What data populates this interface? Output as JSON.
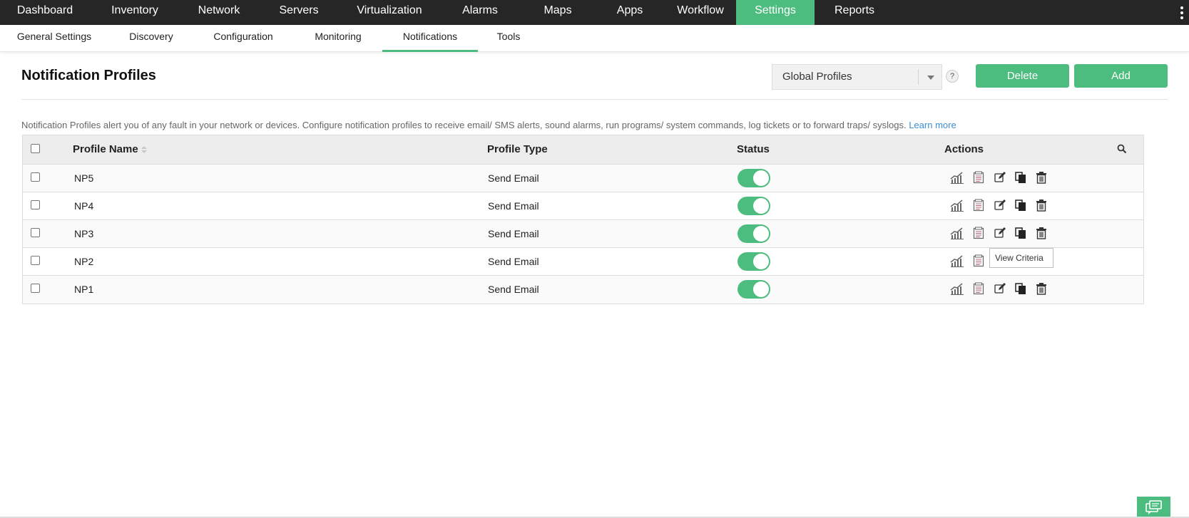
{
  "topnav": {
    "items": [
      "Dashboard",
      "Inventory",
      "Network",
      "Servers",
      "Virtualization",
      "Alarms",
      "Maps",
      "Apps",
      "Workflow",
      "Settings",
      "Reports"
    ],
    "active": "Settings"
  },
  "subnav": {
    "items": [
      "General Settings",
      "Discovery",
      "Configuration",
      "Monitoring",
      "Notifications",
      "Tools"
    ],
    "active": "Notifications"
  },
  "page": {
    "title": "Notification Profiles",
    "profile_select": "Global Profiles",
    "help": "?",
    "delete_label": "Delete",
    "add_label": "Add",
    "description": "Notification Profiles alert you of any fault in your network or devices. Configure notification profiles to receive email/ SMS alerts, sound alarms, run programs/ system commands, log tickets or to forward traps/ syslogs.",
    "learn_more": "Learn more"
  },
  "table": {
    "headers": {
      "profile_name": "Profile Name",
      "profile_type": "Profile Type",
      "status": "Status",
      "actions": "Actions"
    },
    "rows": [
      {
        "name": "NP5",
        "type": "Send Email",
        "enabled": true
      },
      {
        "name": "NP4",
        "type": "Send Email",
        "enabled": true
      },
      {
        "name": "NP3",
        "type": "Send Email",
        "enabled": true
      },
      {
        "name": "NP2",
        "type": "Send Email",
        "enabled": true
      },
      {
        "name": "NP1",
        "type": "Send Email",
        "enabled": true
      }
    ],
    "action_icons": [
      "report-icon",
      "view-criteria-icon",
      "edit-icon",
      "copy-icon",
      "delete-icon"
    ]
  },
  "tooltip": "View Criteria",
  "colors": {
    "accent": "#4dbd7f",
    "nav_bg": "#262626",
    "link": "#3a8fd6"
  }
}
